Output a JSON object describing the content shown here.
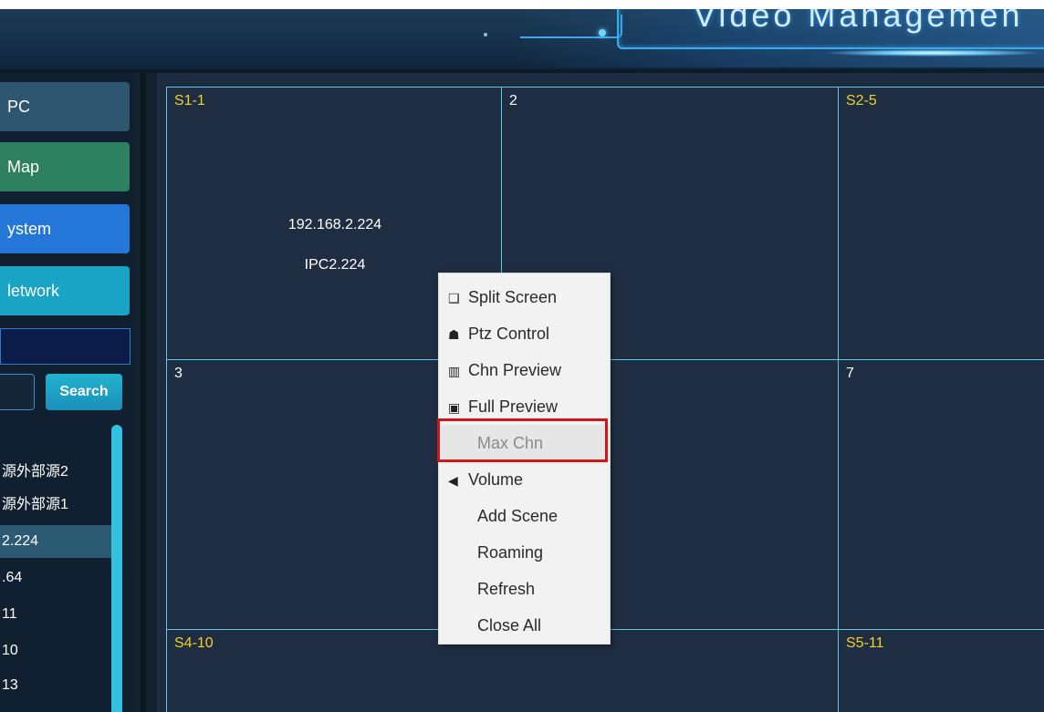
{
  "header": {
    "title": "Video Managemen"
  },
  "nav": {
    "items": [
      {
        "label": "PC"
      },
      {
        "label": "Map"
      },
      {
        "label": "ystem"
      },
      {
        "label": "letwork"
      }
    ]
  },
  "device_panel": {
    "section_label": "",
    "search_placeholder": "",
    "search_button": "Search",
    "tree": [
      {
        "label": "源外部源2"
      },
      {
        "label": "源外部源1"
      },
      {
        "label": "2.224"
      },
      {
        "label": ".64"
      },
      {
        "label": "11"
      },
      {
        "label": "10"
      },
      {
        "label": "13"
      }
    ]
  },
  "grid": {
    "cells": [
      {
        "label": "S1-1",
        "ip": "192.168.2.224",
        "name": "IPC2.224"
      },
      {
        "label": "2"
      },
      {
        "label": "S2-5"
      },
      {
        "label": "3"
      },
      {
        "label": "7"
      },
      {
        "label": "S4-10"
      },
      {
        "label": "S5-11"
      }
    ]
  },
  "context_menu": {
    "items": [
      {
        "label": "Split Screen",
        "icon": "split-screen-icon"
      },
      {
        "label": "Ptz Control",
        "icon": "ptz-icon"
      },
      {
        "label": "Chn Preview",
        "icon": "chn-preview-icon"
      },
      {
        "label": "Full Preview",
        "icon": "full-preview-icon"
      },
      {
        "label": "Max Chn",
        "icon": ""
      },
      {
        "label": "Volume",
        "icon": "volume-icon"
      },
      {
        "label": "Add Scene",
        "icon": ""
      },
      {
        "label": "Roaming",
        "icon": ""
      },
      {
        "label": "Refresh",
        "icon": ""
      },
      {
        "label": "Close All",
        "icon": ""
      }
    ]
  },
  "colors": {
    "yellow_label": "#f0d22a",
    "grid_border": "#5fc7e1",
    "highlight": "#d01616"
  }
}
